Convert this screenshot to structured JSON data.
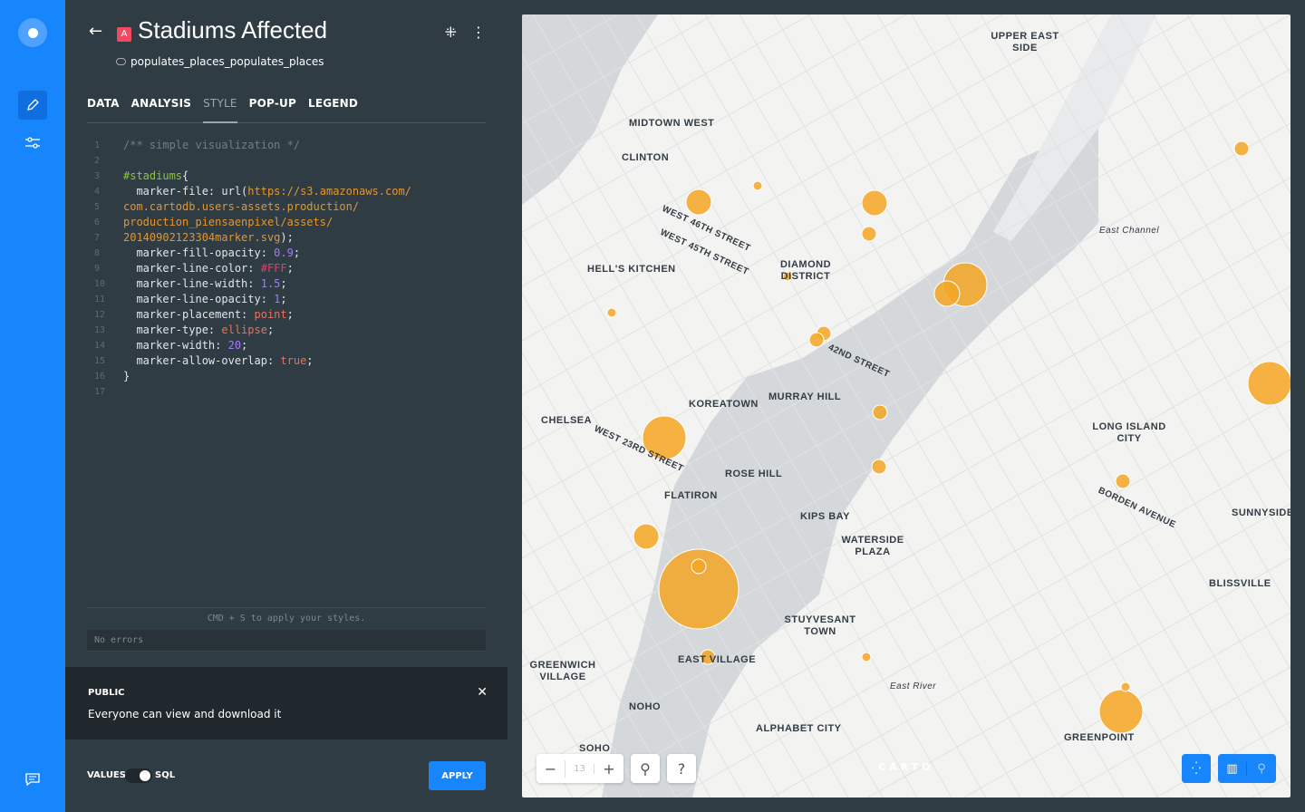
{
  "nav": {
    "items": [
      "style-edit",
      "filters"
    ],
    "accent": "#1785fb"
  },
  "layer": {
    "badge": "A",
    "title": "Stadiums Affected",
    "source": "populates_places_populates_places"
  },
  "tabs": [
    {
      "label": "DATA"
    },
    {
      "label": "ANALYSIS"
    },
    {
      "label": "STYLE",
      "active": true
    },
    {
      "label": "POP-UP"
    },
    {
      "label": "LEGEND"
    }
  ],
  "code": [
    [
      {
        "t": "/** simple visualization */",
        "c": "c"
      }
    ],
    [],
    [
      {
        "t": "#stadiums",
        "c": "g"
      },
      {
        "t": "{",
        "c": "tx"
      }
    ],
    [
      {
        "t": "  marker-file: url(",
        "c": "tx"
      },
      {
        "t": "https://s3.amazonaws.com/",
        "c": "o"
      }
    ],
    [
      {
        "t": "com.cartodb.users-assets.production/",
        "c": "o"
      }
    ],
    [
      {
        "t": "production_piensaenpixel/assets/",
        "c": "o"
      }
    ],
    [
      {
        "t": "20140902123304marker.svg",
        "c": "o"
      },
      {
        "t": ");",
        "c": "tx"
      }
    ],
    [
      {
        "t": "  marker-fill-opacity: ",
        "c": "tx"
      },
      {
        "t": "0.9",
        "c": "p"
      },
      {
        "t": ";",
        "c": "tx"
      }
    ],
    [
      {
        "t": "  marker-line-color: ",
        "c": "tx"
      },
      {
        "t": "#FFF",
        "c": "r"
      },
      {
        "t": ";",
        "c": "tx"
      }
    ],
    [
      {
        "t": "  marker-line-width: ",
        "c": "tx"
      },
      {
        "t": "1.5",
        "c": "p"
      },
      {
        "t": ";",
        "c": "tx"
      }
    ],
    [
      {
        "t": "  marker-line-opacity: ",
        "c": "tx"
      },
      {
        "t": "1",
        "c": "p"
      },
      {
        "t": ";",
        "c": "tx"
      }
    ],
    [
      {
        "t": "  marker-placement: ",
        "c": "tx"
      },
      {
        "t": "point",
        "c": "k"
      },
      {
        "t": ";",
        "c": "tx"
      }
    ],
    [
      {
        "t": "  marker-type: ",
        "c": "tx"
      },
      {
        "t": "ellipse",
        "c": "k"
      },
      {
        "t": ";",
        "c": "tx"
      }
    ],
    [
      {
        "t": "  marker-width: ",
        "c": "tx"
      },
      {
        "t": "20",
        "c": "p"
      },
      {
        "t": ";",
        "c": "tx"
      }
    ],
    [
      {
        "t": "  marker-allow-overlap: ",
        "c": "tx"
      },
      {
        "t": "true",
        "c": "k"
      },
      {
        "t": ";",
        "c": "tx"
      }
    ],
    [
      {
        "t": "}",
        "c": "tx"
      }
    ],
    []
  ],
  "editor": {
    "hint": "CMD + S to apply your styles.",
    "errors": "No errors"
  },
  "notice": {
    "title": "PUBLIC",
    "body": "Everyone can view and download it"
  },
  "footer": {
    "values": "VALUES",
    "sql": "SQL",
    "mode": "SQL",
    "apply": "APPLY"
  },
  "map": {
    "zoom": "13",
    "help": "?",
    "attribution": "CARTO",
    "marker_color": "#f5a623",
    "labels": [
      "MIDTOWN WEST",
      "CLINTON",
      "HELL'S KITCHEN",
      "DIAMOND DISTRICT",
      "KOREATOWN",
      "MURRAY HILL",
      "CHELSEA",
      "ROSE HILL",
      "FLATIRON",
      "KIPS BAY",
      "WATERSIDE PLAZA",
      "STUYVESANT TOWN",
      "EAST VILLAGE",
      "GREENWICH VILLAGE",
      "NOHO",
      "SOHO",
      "ALPHABET CITY",
      "UPPER EAST SIDE",
      "LONG ISLAND CITY",
      "SUNNYSIDE",
      "BLISSVILLE",
      "GREENPOINT",
      "East Channel",
      "East River",
      "BORDEN AVENUE",
      "WEST 46TH STREET",
      "WEST 45TH STREET",
      "42ND STREET",
      "WEST 23RD STREET"
    ]
  }
}
